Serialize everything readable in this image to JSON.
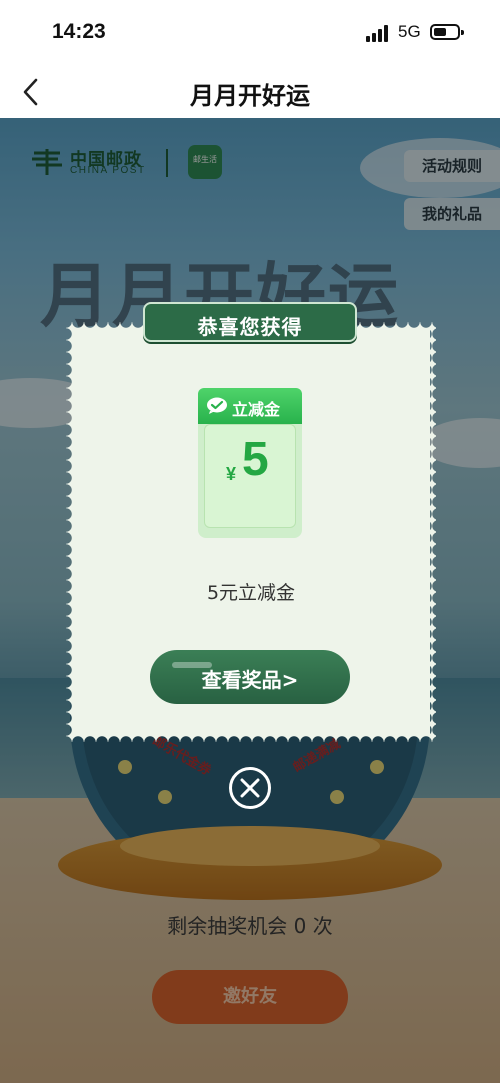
{
  "status_bar": {
    "time": "14:23",
    "network": "5G"
  },
  "nav": {
    "title": "月月开好运"
  },
  "brand": {
    "name_cn": "中国邮政",
    "name_en": "CHINA POST",
    "app_badge": "邮生活"
  },
  "side_buttons": {
    "rules": "活动规则",
    "my_gifts": "我的礼品"
  },
  "hero": {
    "title": "月月开好运"
  },
  "wheel": {
    "segments": [
      "邮乐代金券",
      "邮递满减"
    ]
  },
  "footer": {
    "remaining": "剩余抽奖机会 0 次",
    "invite_button": "邀好友"
  },
  "modal": {
    "banner": "恭喜您获得",
    "coupon_tag": "立减金",
    "coupon_currency": "¥",
    "coupon_amount": "5",
    "prize_name": "5元立减金",
    "view_button": "查看奖品>"
  },
  "colors": {
    "brand_green": "#2c6b47",
    "coupon_green": "#24a743",
    "invite_orange": "#d8632e"
  },
  "icons": [
    "back-chevron-icon",
    "signal-icon",
    "battery-icon",
    "china-post-logo-icon",
    "wechat-pay-icon",
    "close-circle-icon"
  ]
}
